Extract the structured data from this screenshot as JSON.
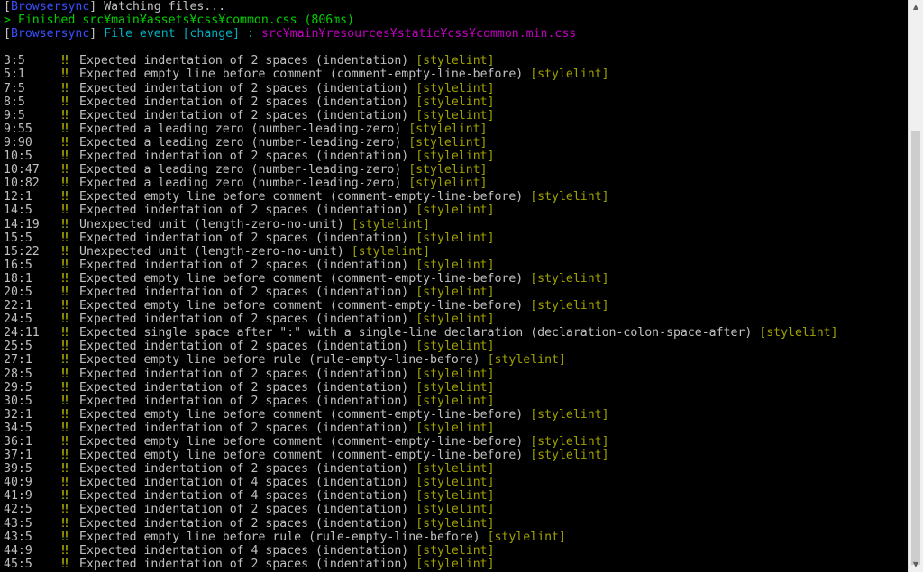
{
  "header": {
    "line1": {
      "tag": "Browsersync",
      "open": "[",
      "close": "]",
      "text": " Watching files..."
    },
    "line2": {
      "arrow": ">",
      "text": " Finished src¥main¥assets¥css¥common.css (806ms)"
    },
    "line3": {
      "tag": "Browsersync",
      "open": "[",
      "close": "]",
      "text": " File event [change] : ",
      "path": "src¥main¥resources¥static¥css¥common.min.css"
    }
  },
  "warn_symbol": "‼",
  "plugin_label": "[stylelint]",
  "lint_rows": [
    {
      "pos": "3:5",
      "msg": "Expected indentation of 2 spaces (indentation)"
    },
    {
      "pos": "5:1",
      "msg": "Expected empty line before comment (comment-empty-line-before)"
    },
    {
      "pos": "7:5",
      "msg": "Expected indentation of 2 spaces (indentation)"
    },
    {
      "pos": "8:5",
      "msg": "Expected indentation of 2 spaces (indentation)"
    },
    {
      "pos": "9:5",
      "msg": "Expected indentation of 2 spaces (indentation)"
    },
    {
      "pos": "9:55",
      "msg": "Expected a leading zero (number-leading-zero)"
    },
    {
      "pos": "9:90",
      "msg": "Expected a leading zero (number-leading-zero)"
    },
    {
      "pos": "10:5",
      "msg": "Expected indentation of 2 spaces (indentation)"
    },
    {
      "pos": "10:47",
      "msg": "Expected a leading zero (number-leading-zero)"
    },
    {
      "pos": "10:82",
      "msg": "Expected a leading zero (number-leading-zero)"
    },
    {
      "pos": "12:1",
      "msg": "Expected empty line before comment (comment-empty-line-before)"
    },
    {
      "pos": "14:5",
      "msg": "Expected indentation of 2 spaces (indentation)"
    },
    {
      "pos": "14:19",
      "msg": "Unexpected unit (length-zero-no-unit)"
    },
    {
      "pos": "15:5",
      "msg": "Expected indentation of 2 spaces (indentation)"
    },
    {
      "pos": "15:22",
      "msg": "Unexpected unit (length-zero-no-unit)"
    },
    {
      "pos": "16:5",
      "msg": "Expected indentation of 2 spaces (indentation)"
    },
    {
      "pos": "18:1",
      "msg": "Expected empty line before comment (comment-empty-line-before)"
    },
    {
      "pos": "20:5",
      "msg": "Expected indentation of 2 spaces (indentation)"
    },
    {
      "pos": "22:1",
      "msg": "Expected empty line before comment (comment-empty-line-before)"
    },
    {
      "pos": "24:5",
      "msg": "Expected indentation of 2 spaces (indentation)"
    },
    {
      "pos": "24:11",
      "msg": "Expected single space after \":\" with a single-line declaration (declaration-colon-space-after)"
    },
    {
      "pos": "25:5",
      "msg": "Expected indentation of 2 spaces (indentation)"
    },
    {
      "pos": "27:1",
      "msg": "Expected empty line before rule (rule-empty-line-before)"
    },
    {
      "pos": "28:5",
      "msg": "Expected indentation of 2 spaces (indentation)"
    },
    {
      "pos": "29:5",
      "msg": "Expected indentation of 2 spaces (indentation)"
    },
    {
      "pos": "30:5",
      "msg": "Expected indentation of 2 spaces (indentation)"
    },
    {
      "pos": "32:1",
      "msg": "Expected empty line before comment (comment-empty-line-before)"
    },
    {
      "pos": "34:5",
      "msg": "Expected indentation of 2 spaces (indentation)"
    },
    {
      "pos": "36:1",
      "msg": "Expected empty line before comment (comment-empty-line-before)"
    },
    {
      "pos": "37:1",
      "msg": "Expected empty line before comment (comment-empty-line-before)"
    },
    {
      "pos": "39:5",
      "msg": "Expected indentation of 2 spaces (indentation)"
    },
    {
      "pos": "40:9",
      "msg": "Expected indentation of 4 spaces (indentation)"
    },
    {
      "pos": "41:9",
      "msg": "Expected indentation of 4 spaces (indentation)"
    },
    {
      "pos": "42:5",
      "msg": "Expected indentation of 2 spaces (indentation)"
    },
    {
      "pos": "43:5",
      "msg": "Expected indentation of 2 spaces (indentation)"
    },
    {
      "pos": "43:5",
      "msg": "Expected empty line before rule (rule-empty-line-before)"
    },
    {
      "pos": "44:9",
      "msg": "Expected indentation of 4 spaces (indentation)"
    },
    {
      "pos": "45:5",
      "msg": "Expected indentation of 2 spaces (indentation)"
    }
  ],
  "colors": {
    "background": "#000000",
    "text": "#c0c0c0",
    "browsersync": "#3a4fff",
    "finished": "#00d000",
    "file_event": "#00b0c0",
    "path": "#c000c0",
    "warn": "#c8c800",
    "plugin": "#a0a000"
  },
  "scrollbar": {
    "up_icon": "▲",
    "down_icon": "▼"
  }
}
